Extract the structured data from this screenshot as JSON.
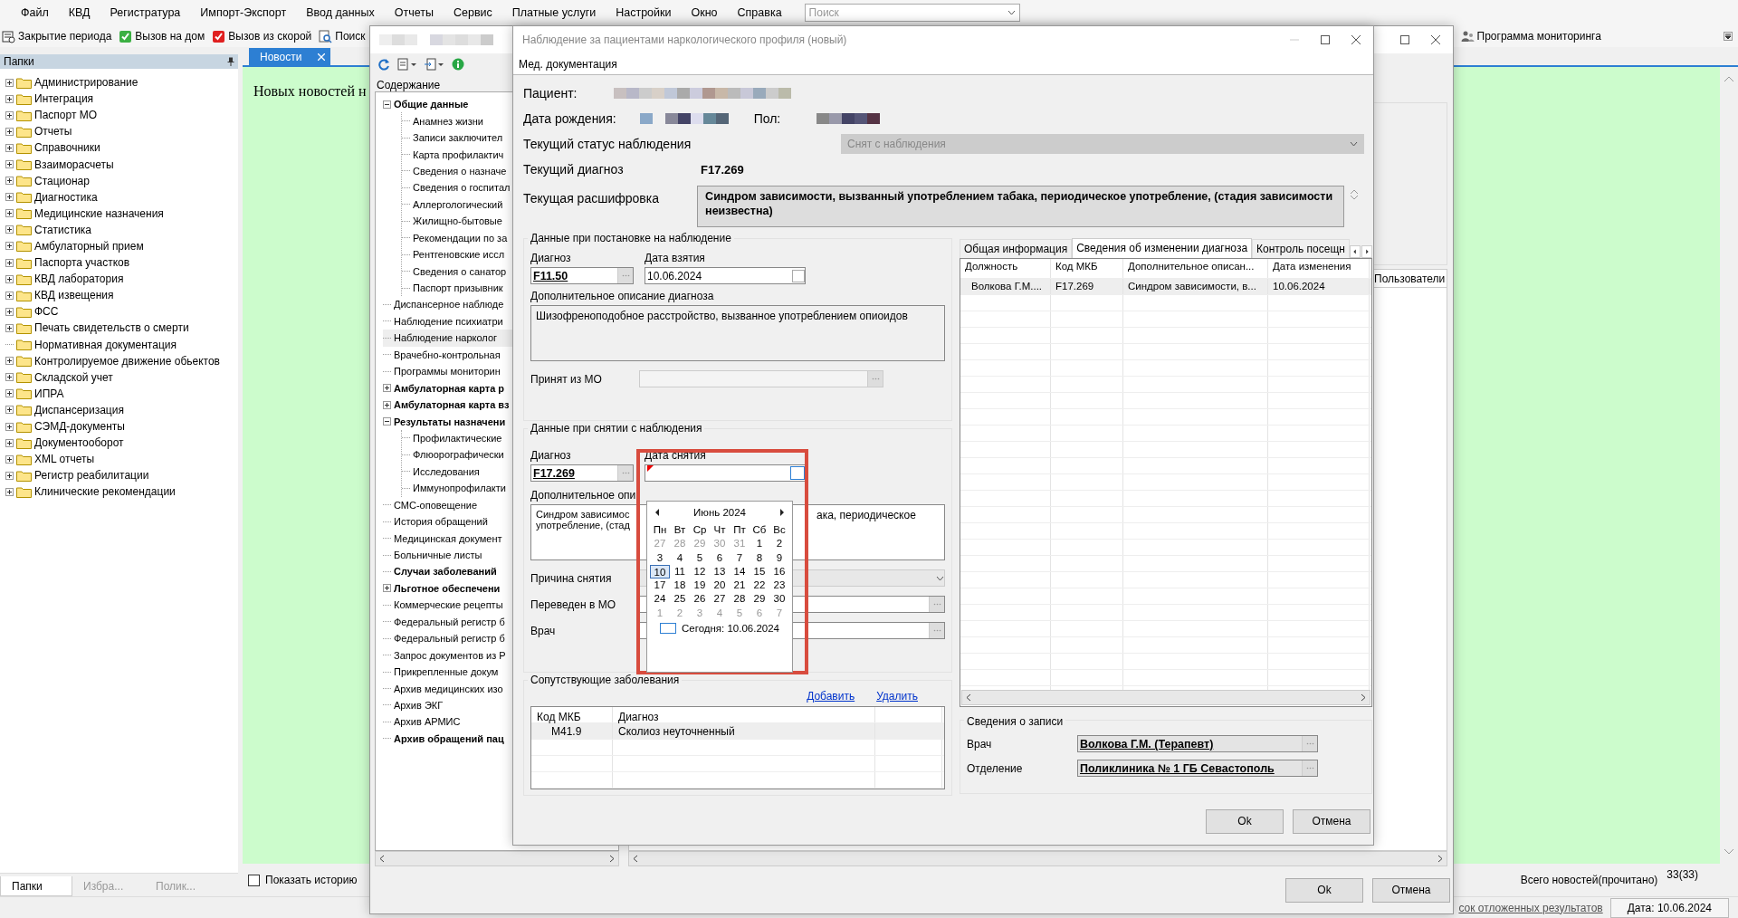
{
  "menu": [
    "Файл",
    "КВД",
    "Регистратура",
    "Импорт-Экспорт",
    "Ввод данных",
    "Отчеты",
    "Сервис",
    "Платные услуги",
    "Настройки",
    "Окно",
    "Справка"
  ],
  "search": {
    "placeholder": "Поиск"
  },
  "toolbar": [
    {
      "kind": "period",
      "label": "Закрытие периода"
    },
    {
      "kind": "home",
      "label": "Вызов на дом"
    },
    {
      "kind": "ambulance",
      "label": "Вызов из скорой"
    },
    {
      "kind": "search",
      "label": "Поиск"
    }
  ],
  "toolbar_right": {
    "label": "Программа мониторинга"
  },
  "folders": {
    "title": "Папки",
    "items": [
      {
        "label": "Администрирование",
        "kind": "group",
        "expanded": false
      },
      {
        "label": "Интеграция",
        "kind": "group",
        "expanded": false
      },
      {
        "label": "Паспорт МО",
        "kind": "group",
        "expanded": false
      },
      {
        "label": "Отчеты",
        "kind": "group",
        "expanded": false
      },
      {
        "label": "Справочники",
        "kind": "group",
        "expanded": false
      },
      {
        "label": "Взаиморасчеты",
        "kind": "group",
        "expanded": false
      },
      {
        "label": "Стационар",
        "kind": "group",
        "expanded": false
      },
      {
        "label": "Диагностика",
        "kind": "group",
        "expanded": false
      },
      {
        "label": "Медицинские назначения",
        "kind": "group",
        "expanded": false
      },
      {
        "label": "Статистика",
        "kind": "group",
        "expanded": false
      },
      {
        "label": "Амбулаторный прием",
        "kind": "group",
        "expanded": false
      },
      {
        "label": "Паспорта участков",
        "kind": "group",
        "expanded": false
      },
      {
        "label": "КВД лаборатория",
        "kind": "group",
        "expanded": false
      },
      {
        "label": "КВД извещения",
        "kind": "group",
        "expanded": false
      },
      {
        "label": "ФСС",
        "kind": "group",
        "expanded": false
      },
      {
        "label": "Печать свидетельств о смерти",
        "kind": "group",
        "expanded": false
      },
      {
        "label": "Нормативная документация",
        "kind": "leaf"
      },
      {
        "label": "Контролируемое движение обьектов",
        "kind": "group",
        "expanded": false
      },
      {
        "label": "Складской учет",
        "kind": "group",
        "expanded": false
      },
      {
        "label": "ИПРА",
        "kind": "group",
        "expanded": false
      },
      {
        "label": "Диспансеризация",
        "kind": "group",
        "expanded": false
      },
      {
        "label": "СЭМД-документы",
        "kind": "group",
        "expanded": false
      },
      {
        "label": "Документооборот",
        "kind": "group",
        "expanded": false
      },
      {
        "label": "XML отчеты",
        "kind": "group",
        "expanded": false
      },
      {
        "label": "Регистр реабилитации",
        "kind": "group",
        "expanded": false
      },
      {
        "label": "Клинические рекомендации",
        "kind": "group",
        "expanded": false
      }
    ],
    "tabs": [
      {
        "label": "Папки",
        "selected": true
      },
      {
        "label": "Избра...",
        "selected": false
      },
      {
        "label": "Полик...",
        "selected": false
      }
    ]
  },
  "news": {
    "tab": "Новости",
    "message": "Новых новостей н",
    "show_history": {
      "label": "Показать историю",
      "checked": false
    },
    "total_label": "Всего новостей(прочитано)",
    "total_count": "33(33)"
  },
  "status_bar": {
    "link": "сок отложенных результатов",
    "date": "Дата: 10.06.2024"
  },
  "med_window": {
    "contents_title": "Содержание",
    "tree": [
      {
        "label": "Общие данные",
        "kind": "group",
        "expanded": true,
        "bold": true,
        "selected": false,
        "children": [
          {
            "label": "Анамнез жизни",
            "kind": "leaf",
            "bold": false,
            "selected": false
          },
          {
            "label": "Записи заключител",
            "kind": "leaf",
            "bold": false,
            "selected": false
          },
          {
            "label": "Карта профилактич",
            "kind": "leaf",
            "bold": false,
            "selected": false
          },
          {
            "label": "Сведения о назначе",
            "kind": "leaf",
            "bold": false,
            "selected": false
          },
          {
            "label": "Сведения о госпитал",
            "kind": "leaf",
            "bold": false,
            "selected": false
          },
          {
            "label": "Аллергологический",
            "kind": "leaf",
            "bold": false,
            "selected": false
          },
          {
            "label": "Жилищно-бытовые",
            "kind": "leaf",
            "bold": false,
            "selected": false
          },
          {
            "label": "Рекомендации по за",
            "kind": "leaf",
            "bold": false,
            "selected": false
          },
          {
            "label": "Рентгеновские иссл",
            "kind": "leaf",
            "bold": false,
            "selected": false
          },
          {
            "label": "Сведения о санатор",
            "kind": "leaf",
            "bold": false,
            "selected": false
          },
          {
            "label": "Паспорт призывник",
            "kind": "leaf",
            "bold": false,
            "selected": false
          }
        ]
      },
      {
        "label": "Диспансерное наблюде",
        "kind": "leaf",
        "bold": false,
        "selected": false
      },
      {
        "label": "Наблюдение психиатри",
        "kind": "leaf",
        "bold": false,
        "selected": false
      },
      {
        "label": "Наблюдение нарколог",
        "kind": "leaf",
        "bold": false,
        "selected": true
      },
      {
        "label": "Врачебно-контрольная",
        "kind": "leaf",
        "bold": false,
        "selected": false
      },
      {
        "label": "Программы мониторин",
        "kind": "leaf",
        "bold": false,
        "selected": false
      },
      {
        "label": "Амбулаторная карта р",
        "kind": "group",
        "expanded": false,
        "bold": true,
        "selected": false
      },
      {
        "label": "Амбулаторная карта вз",
        "kind": "group",
        "expanded": false,
        "bold": true,
        "selected": false
      },
      {
        "label": "Результаты назначени",
        "kind": "group",
        "expanded": true,
        "bold": true,
        "selected": false,
        "children": [
          {
            "label": "Профилактические",
            "kind": "leaf",
            "bold": false,
            "selected": false
          },
          {
            "label": "Флюорографически",
            "kind": "leaf",
            "bold": false,
            "selected": false
          },
          {
            "label": "Исследования",
            "kind": "leaf",
            "bold": false,
            "selected": false
          },
          {
            "label": "Иммунопрофилакти",
            "kind": "leaf",
            "bold": false,
            "selected": false
          }
        ]
      },
      {
        "label": "СМС-оповещение",
        "kind": "leaf",
        "bold": false,
        "selected": false
      },
      {
        "label": "История обращений",
        "kind": "leaf",
        "bold": false,
        "selected": false
      },
      {
        "label": "Медицинская документ",
        "kind": "leaf",
        "bold": false,
        "selected": false
      },
      {
        "label": "Больничные листы",
        "kind": "leaf",
        "bold": false,
        "selected": false
      },
      {
        "label": "Случаи заболеваний",
        "kind": "leaf",
        "bold": true,
        "selected": false
      },
      {
        "label": "Льготное обеспечени",
        "kind": "group",
        "expanded": false,
        "bold": true,
        "selected": false
      },
      {
        "label": "Коммерческие рецепты",
        "kind": "leaf",
        "bold": false,
        "selected": false
      },
      {
        "label": "Федеральный регистр б",
        "kind": "leaf",
        "bold": false,
        "selected": false
      },
      {
        "label": "Федеральный регистр б",
        "kind": "leaf",
        "bold": false,
        "selected": false
      },
      {
        "label": "Запрос документов из Р",
        "kind": "leaf",
        "bold": false,
        "selected": false
      },
      {
        "label": "Прикрепленные докум",
        "kind": "leaf",
        "bold": false,
        "selected": false
      },
      {
        "label": "Архив медицинских изо",
        "kind": "leaf",
        "bold": false,
        "selected": false
      },
      {
        "label": "Архив ЭКГ",
        "kind": "leaf",
        "bold": false,
        "selected": false
      },
      {
        "label": "Архив АРМИС",
        "kind": "leaf",
        "bold": false,
        "selected": false
      },
      {
        "label": "Архив обращений пац",
        "kind": "leaf",
        "bold": true,
        "selected": false
      }
    ],
    "side_tab": "Пользователи",
    "buttons": [
      "Ok",
      "Отмена"
    ]
  },
  "dialog": {
    "title": "Наблюдение за пациентами наркологического профиля (новый)",
    "menu": "Мед. документация",
    "patient_label": "Пациент:",
    "birth_label": "Дата рождения:",
    "sex_label": "Пол:",
    "status": {
      "label": "Текущий статус наблюдения",
      "value": "Снят с наблюдения",
      "disabled": true
    },
    "diagnosis": {
      "label": "Текущий диагноз",
      "value": "F17.269"
    },
    "decoding": {
      "label": "Текущая расшифровка",
      "value": "Синдром зависимости, вызванный употреблением табака, периодическое употребление, (стадия зависимости неизвестна)"
    },
    "registration": {
      "title": "Данные при постановке на наблюдение",
      "diagnosis_label": "Диагноз",
      "diagnosis": "F11.50",
      "date_label": "Дата взятия",
      "date": "10.06.2024",
      "description_label": "Дополнительное описание диагноза",
      "description": "Шизофреноподобное расстройство, вызванное употреблением опиоидов",
      "from_mo_label": "Принят из МО"
    },
    "removal": {
      "title": "Данные при снятии с наблюдения",
      "diagnosis_label": "Диагноз",
      "diagnosis": "F17.269",
      "date_label": "Дата снятия",
      "date_invalid": true,
      "description_label": "Дополнительное опи",
      "description_left": [
        "Синдром зависимос",
        "употребление, (стад"
      ],
      "description_right": "ака, периодическое",
      "reason_label": "Причина снятия",
      "moved_label": "Переведен в МО",
      "doctor_label": "Врач"
    },
    "calendar": {
      "month": "Июнь 2024",
      "weekdays": [
        "Пн",
        "Вт",
        "Ср",
        "Чт",
        "Пт",
        "Сб",
        "Вс"
      ],
      "days": [
        {
          "label": "27",
          "outside": true,
          "selected": false
        },
        {
          "label": "28",
          "outside": true,
          "selected": false
        },
        {
          "label": "29",
          "outside": true,
          "selected": false
        },
        {
          "label": "30",
          "outside": true,
          "selected": false
        },
        {
          "label": "31",
          "outside": true,
          "selected": false
        },
        {
          "label": "1",
          "outside": false,
          "selected": false
        },
        {
          "label": "2",
          "outside": false,
          "selected": false
        },
        {
          "label": "3",
          "outside": false,
          "selected": false
        },
        {
          "label": "4",
          "outside": false,
          "selected": false
        },
        {
          "label": "5",
          "outside": false,
          "selected": false
        },
        {
          "label": "6",
          "outside": false,
          "selected": false
        },
        {
          "label": "7",
          "outside": false,
          "selected": false
        },
        {
          "label": "8",
          "outside": false,
          "selected": false
        },
        {
          "label": "9",
          "outside": false,
          "selected": false
        },
        {
          "label": "10",
          "outside": false,
          "selected": true
        },
        {
          "label": "11",
          "outside": false,
          "selected": false
        },
        {
          "label": "12",
          "outside": false,
          "selected": false
        },
        {
          "label": "13",
          "outside": false,
          "selected": false
        },
        {
          "label": "14",
          "outside": false,
          "selected": false
        },
        {
          "label": "15",
          "outside": false,
          "selected": false
        },
        {
          "label": "16",
          "outside": false,
          "selected": false
        },
        {
          "label": "17",
          "outside": false,
          "selected": false
        },
        {
          "label": "18",
          "outside": false,
          "selected": false
        },
        {
          "label": "19",
          "outside": false,
          "selected": false
        },
        {
          "label": "20",
          "outside": false,
          "selected": false
        },
        {
          "label": "21",
          "outside": false,
          "selected": false
        },
        {
          "label": "22",
          "outside": false,
          "selected": false
        },
        {
          "label": "23",
          "outside": false,
          "selected": false
        },
        {
          "label": "24",
          "outside": false,
          "selected": false
        },
        {
          "label": "25",
          "outside": false,
          "selected": false
        },
        {
          "label": "26",
          "outside": false,
          "selected": false
        },
        {
          "label": "27",
          "outside": false,
          "selected": false
        },
        {
          "label": "28",
          "outside": false,
          "selected": false
        },
        {
          "label": "29",
          "outside": false,
          "selected": false
        },
        {
          "label": "30",
          "outside": false,
          "selected": false
        },
        {
          "label": "1",
          "outside": true,
          "selected": false
        },
        {
          "label": "2",
          "outside": true,
          "selected": false
        },
        {
          "label": "3",
          "outside": true,
          "selected": false
        },
        {
          "label": "4",
          "outside": true,
          "selected": false
        },
        {
          "label": "5",
          "outside": true,
          "selected": false
        },
        {
          "label": "6",
          "outside": true,
          "selected": false
        },
        {
          "label": "7",
          "outside": true,
          "selected": false
        }
      ],
      "today": "Сегодня: 10.06.2024"
    },
    "comorbid": {
      "title": "Сопутствующие заболевания",
      "add": "Добавить",
      "remove": "Удалить",
      "columns": [
        "Код МКБ",
        "Диагноз"
      ],
      "rows": [
        [
          "M41.9",
          "Сколиоз неуточненный"
        ]
      ]
    },
    "tabs": [
      {
        "label": "Общая информация",
        "selected": false
      },
      {
        "label": "Сведения об изменении диагноза",
        "selected": true
      },
      {
        "label": "Контроль посещн",
        "selected": false
      }
    ],
    "history": {
      "columns": [
        "Должность",
        "Код МКБ",
        "Дополнительное описан...",
        "Дата изменения"
      ],
      "rows": [
        [
          "Волкова Г.М....",
          "F17.269",
          "Синдром зависимости, в...",
          "10.06.2024"
        ]
      ]
    },
    "record": {
      "title": "Сведения о записи",
      "doctor_label": "Врач",
      "doctor": "Волкова Г.М. (Терапевт)",
      "department_label": "Отделение",
      "department": "Поликлиника № 1 ГБ Севастополь"
    },
    "buttons": [
      "Ok",
      "Отмена"
    ]
  }
}
